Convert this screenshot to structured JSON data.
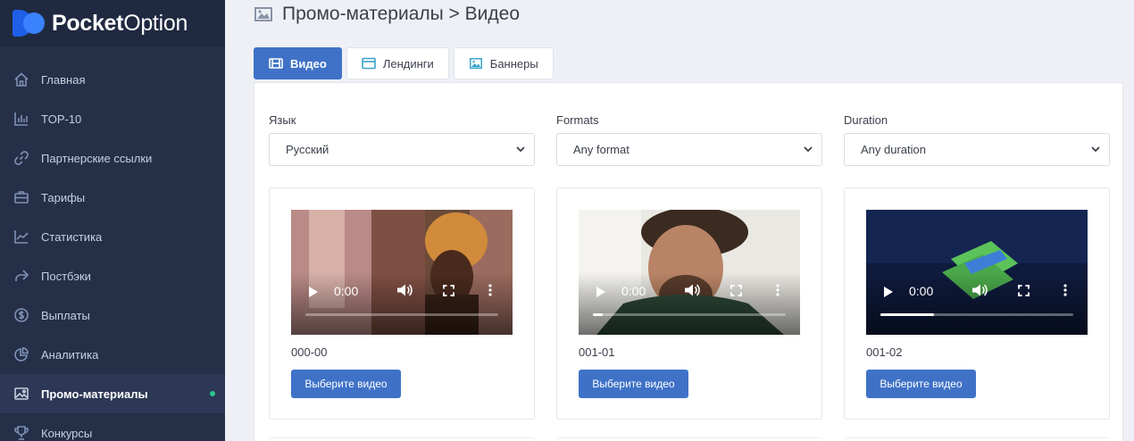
{
  "brand": {
    "name_bold": "Pocket",
    "name_regular": "Option"
  },
  "sidebar": {
    "items": [
      {
        "label": "Главная",
        "icon": "home-icon"
      },
      {
        "label": "TOP-10",
        "icon": "bar-chart-icon"
      },
      {
        "label": "Партнерские ссылки",
        "icon": "link-icon"
      },
      {
        "label": "Тарифы",
        "icon": "briefcase-icon"
      },
      {
        "label": "Статистика",
        "icon": "line-chart-icon"
      },
      {
        "label": "Постбэки",
        "icon": "share-icon"
      },
      {
        "label": "Выплаты",
        "icon": "dollar-icon"
      },
      {
        "label": "Аналитика",
        "icon": "pie-chart-icon"
      },
      {
        "label": "Промо-материалы",
        "icon": "image-icon",
        "active": true
      },
      {
        "label": "Конкурсы",
        "icon": "trophy-icon"
      }
    ],
    "active_dot_color": "#2bc98f"
  },
  "header": {
    "title": "Промо-материалы > Видео",
    "icon": "image-icon"
  },
  "tabs": [
    {
      "label": "Видео",
      "icon": "film-icon",
      "active": true
    },
    {
      "label": "Лендинги",
      "icon": "browser-icon"
    },
    {
      "label": "Баннеры",
      "icon": "image-icon"
    }
  ],
  "filters": {
    "language": {
      "label": "Язык",
      "value": "Русский"
    },
    "formats": {
      "label": "Formats",
      "value": "Any format"
    },
    "duration": {
      "label": "Duration",
      "value": "Any duration"
    }
  },
  "videos": [
    {
      "name": "000-00",
      "time": "0:00",
      "progress": 0,
      "button": "Выберите видео"
    },
    {
      "name": "001-01",
      "time": "0:00",
      "progress": 0.05,
      "button": "Выберите видео"
    },
    {
      "name": "001-02",
      "time": "0:00",
      "progress": 0.28,
      "button": "Выберите видео"
    }
  ],
  "colors": {
    "accent": "#3f72c7",
    "sidebar": "#253048"
  }
}
